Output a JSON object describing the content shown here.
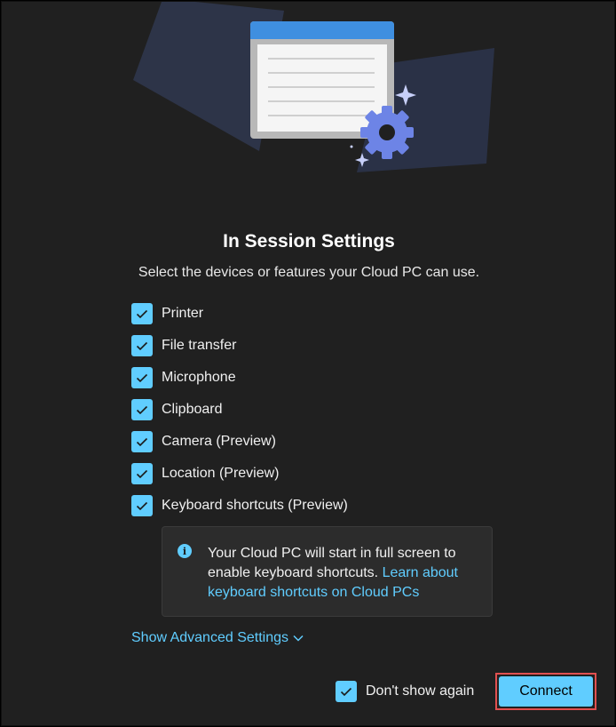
{
  "dialog": {
    "title": "In Session Settings",
    "subtitle": "Select the devices or features your Cloud PC can use."
  },
  "options": [
    {
      "label": "Printer",
      "checked": true
    },
    {
      "label": "File transfer",
      "checked": true
    },
    {
      "label": "Microphone",
      "checked": true
    },
    {
      "label": "Clipboard",
      "checked": true
    },
    {
      "label": "Camera (Preview)",
      "checked": true
    },
    {
      "label": "Location (Preview)",
      "checked": true
    },
    {
      "label": "Keyboard shortcuts (Preview)",
      "checked": true
    }
  ],
  "info": {
    "text": "Your Cloud PC will start in full screen to enable keyboard shortcuts.",
    "link": "Learn about keyboard shortcuts on Cloud PCs"
  },
  "advanced": {
    "label": "Show Advanced Settings"
  },
  "footer": {
    "dont_show_label": "Don't show again",
    "dont_show_checked": true,
    "connect_label": "Connect"
  },
  "colors": {
    "accent": "#60cdff",
    "background": "#202020",
    "highlight_border": "#e05050"
  }
}
